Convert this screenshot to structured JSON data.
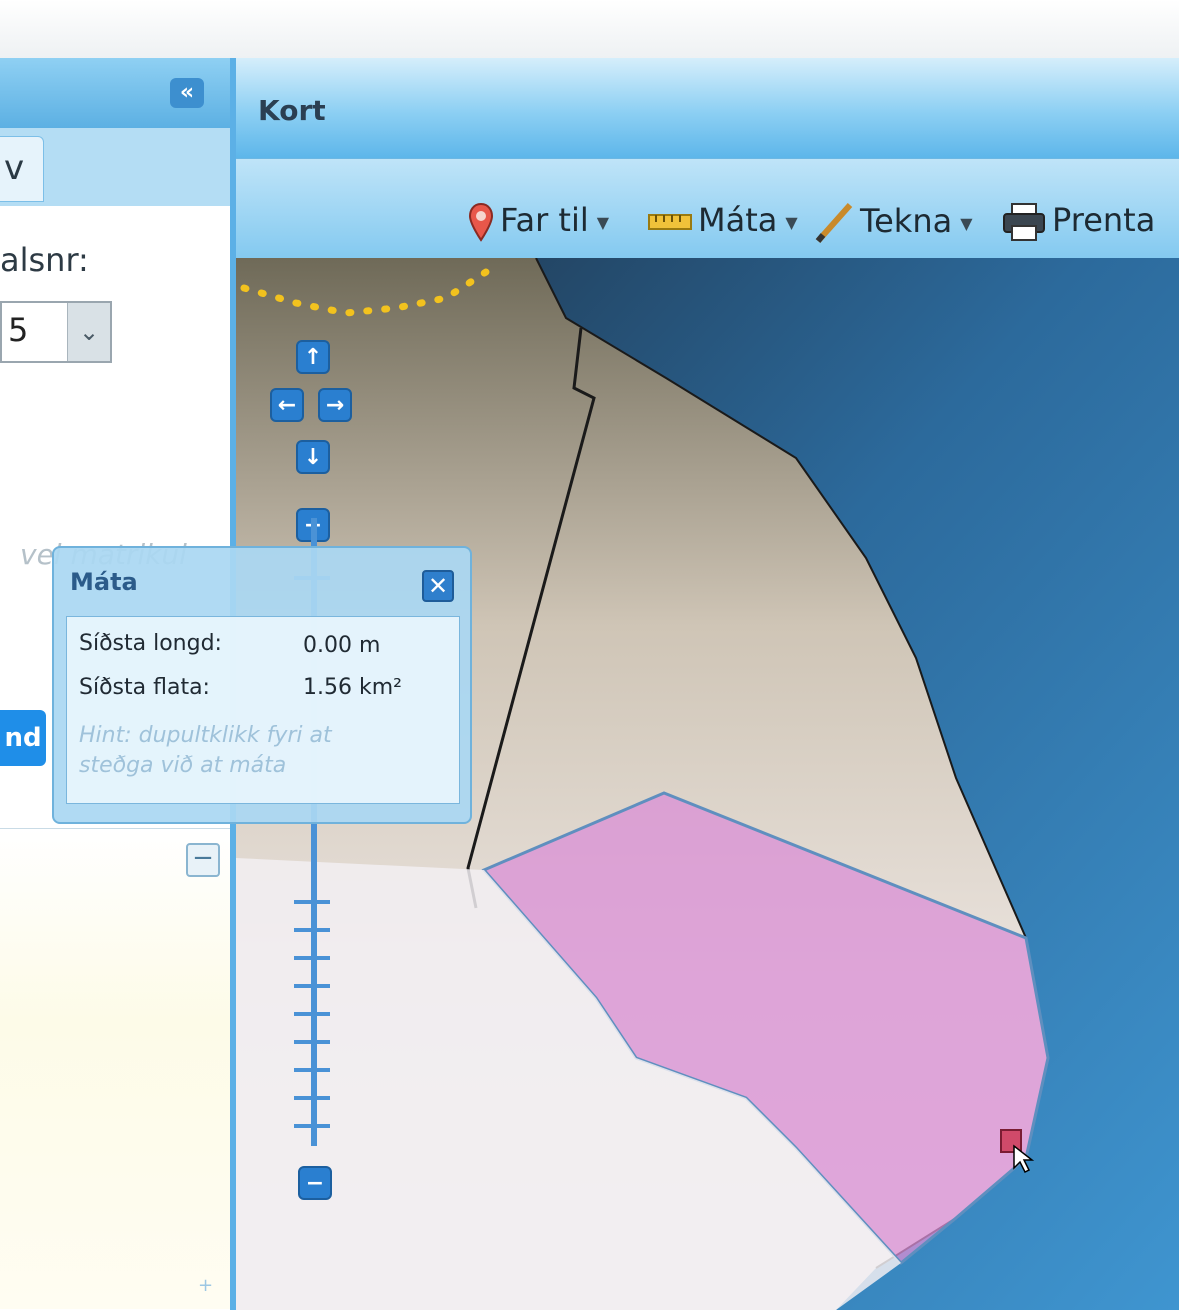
{
  "colors": {
    "accent": "#5cb0e6",
    "toolbar": "#7cc6ef",
    "nav_button": "#2a7fd0",
    "area_fill": "#d98fd6",
    "sea": "#3f8ec9"
  },
  "sidebar": {
    "collapse_icon": "double-chevron-left-icon",
    "collapse_label": "«",
    "tab_label": "v",
    "field_label": "alsnr:",
    "select_value": "5",
    "placeholder_hint": "vel matrikul",
    "button_label": "nd"
  },
  "map": {
    "title": "Kort",
    "toolbar": {
      "goto_label": "Far til",
      "measure_label": "Máta",
      "draw_label": "Tekna",
      "print_label": "Prenta"
    },
    "nav": {
      "up": "↑",
      "left": "←",
      "right": "→",
      "down": "↓",
      "zoom_in": "+",
      "zoom_out": "−"
    }
  },
  "measure_popup": {
    "title": "Máta",
    "close": "✕",
    "last_length_label": "Síðsta longd:",
    "last_length_value": "0.00 m",
    "last_area_label": "Síðsta flata:",
    "last_area_value": "1.56 km²",
    "hint": "Hint: dupultklikk fyri at steðga við at máta"
  }
}
